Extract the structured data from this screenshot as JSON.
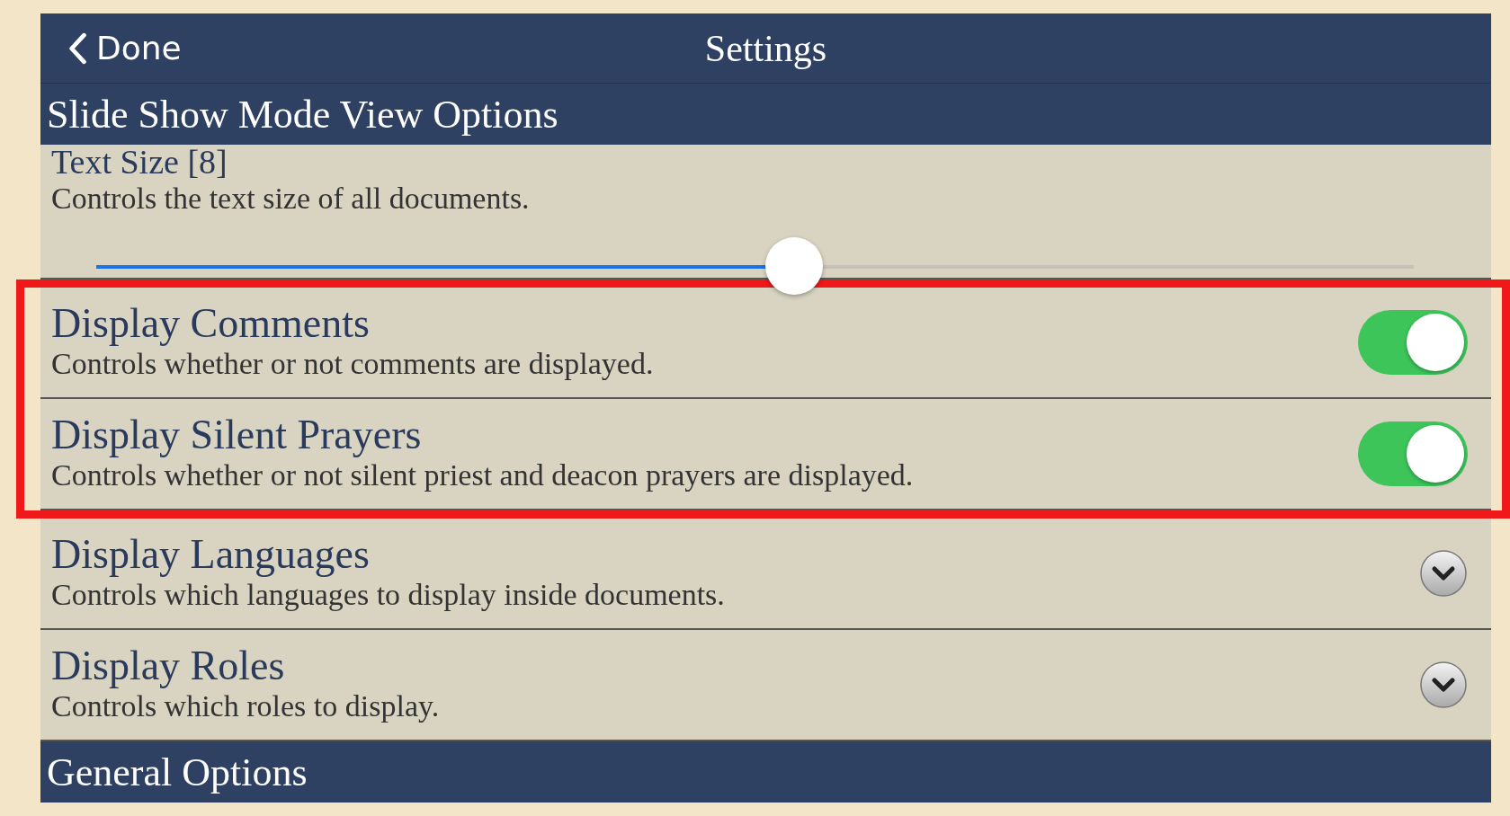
{
  "nav": {
    "back_label": "Done",
    "title": "Settings"
  },
  "sections": [
    {
      "header": "Slide Show Mode View Options",
      "rows": [
        {
          "kind": "slider",
          "title": "Text Size [8]",
          "subtitle": "Controls the text size of all documents.",
          "level": 0.53,
          "highlighted": false
        },
        {
          "kind": "toggle",
          "title": "Display Comments",
          "subtitle": "Controls whether or not comments are displayed.",
          "on": true,
          "highlighted": true
        },
        {
          "kind": "toggle",
          "title": "Display Silent Prayers",
          "subtitle": "Controls whether or not silent priest and deacon prayers are displayed.",
          "on": true,
          "highlighted": true
        },
        {
          "kind": "dropdown",
          "title": "Display Languages",
          "subtitle": "Controls which languages to display inside documents.",
          "highlighted": false
        },
        {
          "kind": "dropdown",
          "title": "Display Roles",
          "subtitle": "Controls which roles to display.",
          "highlighted": false
        }
      ]
    },
    {
      "header": "General Options"
    }
  ]
}
